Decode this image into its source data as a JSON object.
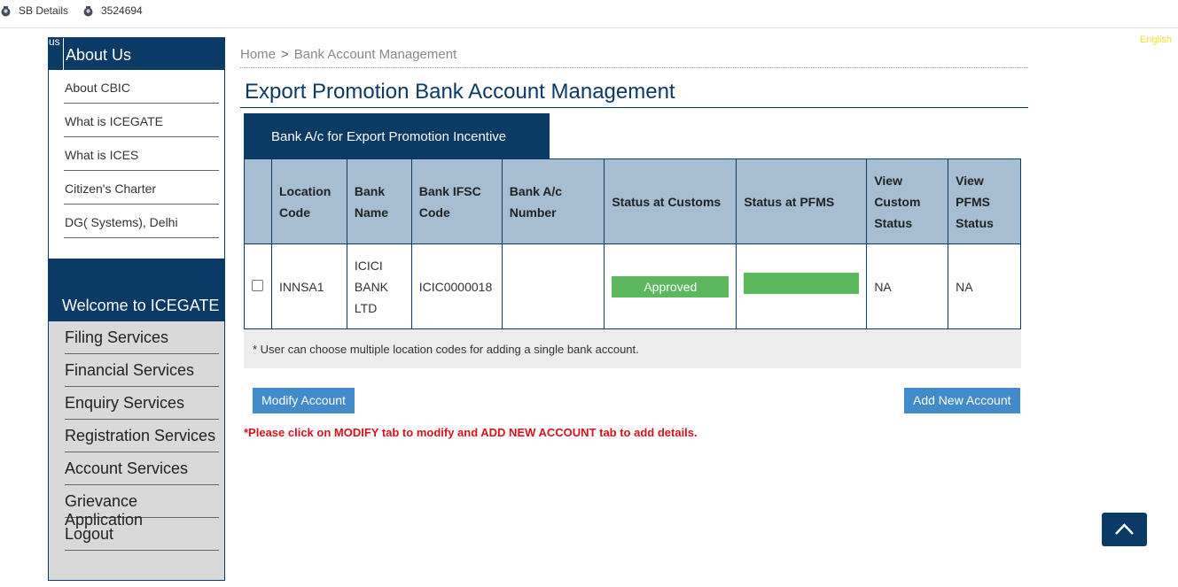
{
  "topbar": {
    "items": [
      {
        "label": "SB Details",
        "icon": "badge-icon"
      },
      {
        "label": "3524694",
        "icon": "badge-icon"
      }
    ],
    "language": "English"
  },
  "sidebar": {
    "corner_text": "us",
    "about_title": "About Us",
    "about_items": [
      "About CBIC",
      "What is ICEGATE",
      "What is ICES",
      "Citizen's Charter",
      "DG( Systems), Delhi"
    ],
    "welcome_title": "Welcome to ICEGATE",
    "service_items": [
      "Filing Services",
      "Financial Services",
      "Enquiry Services",
      "Registration Services",
      "Account Services",
      "Grievance Application",
      "Logout"
    ]
  },
  "breadcrumb": {
    "home": "Home",
    "separator": ">",
    "current": "Bank Account Management"
  },
  "page_title": "Export Promotion Bank Account Management",
  "tab_label": "Bank A/c for Export Promotion Incentive",
  "table": {
    "headers": [
      "",
      "Location Code",
      "Bank Name",
      "Bank IFSC Code",
      "Bank A/c Number",
      "Status at Customs",
      "Status at PFMS",
      "View Custom Status",
      "View PFMS Status"
    ],
    "rows": [
      {
        "location_code": "INNSA1",
        "bank_name": "ICICI BANK LTD",
        "ifsc": "ICIC0000018",
        "account_number": "",
        "status_customs": "Approved",
        "status_pfms": "",
        "view_custom_status": "NA",
        "view_pfms_status": "NA"
      }
    ]
  },
  "note": "* User can choose multiple location codes for adding a single bank account.",
  "buttons": {
    "modify": "Modify Account",
    "add_new": "Add New Account"
  },
  "warning": "*Please click on MODIFY tab to modify and ADD NEW ACCOUNT tab to add details.",
  "colors": {
    "navy": "#0a3a66",
    "status_green": "#5cb85c",
    "button_blue": "#428bca",
    "warning_red": "#d9121f",
    "header_blue": "#a7bdd2"
  }
}
